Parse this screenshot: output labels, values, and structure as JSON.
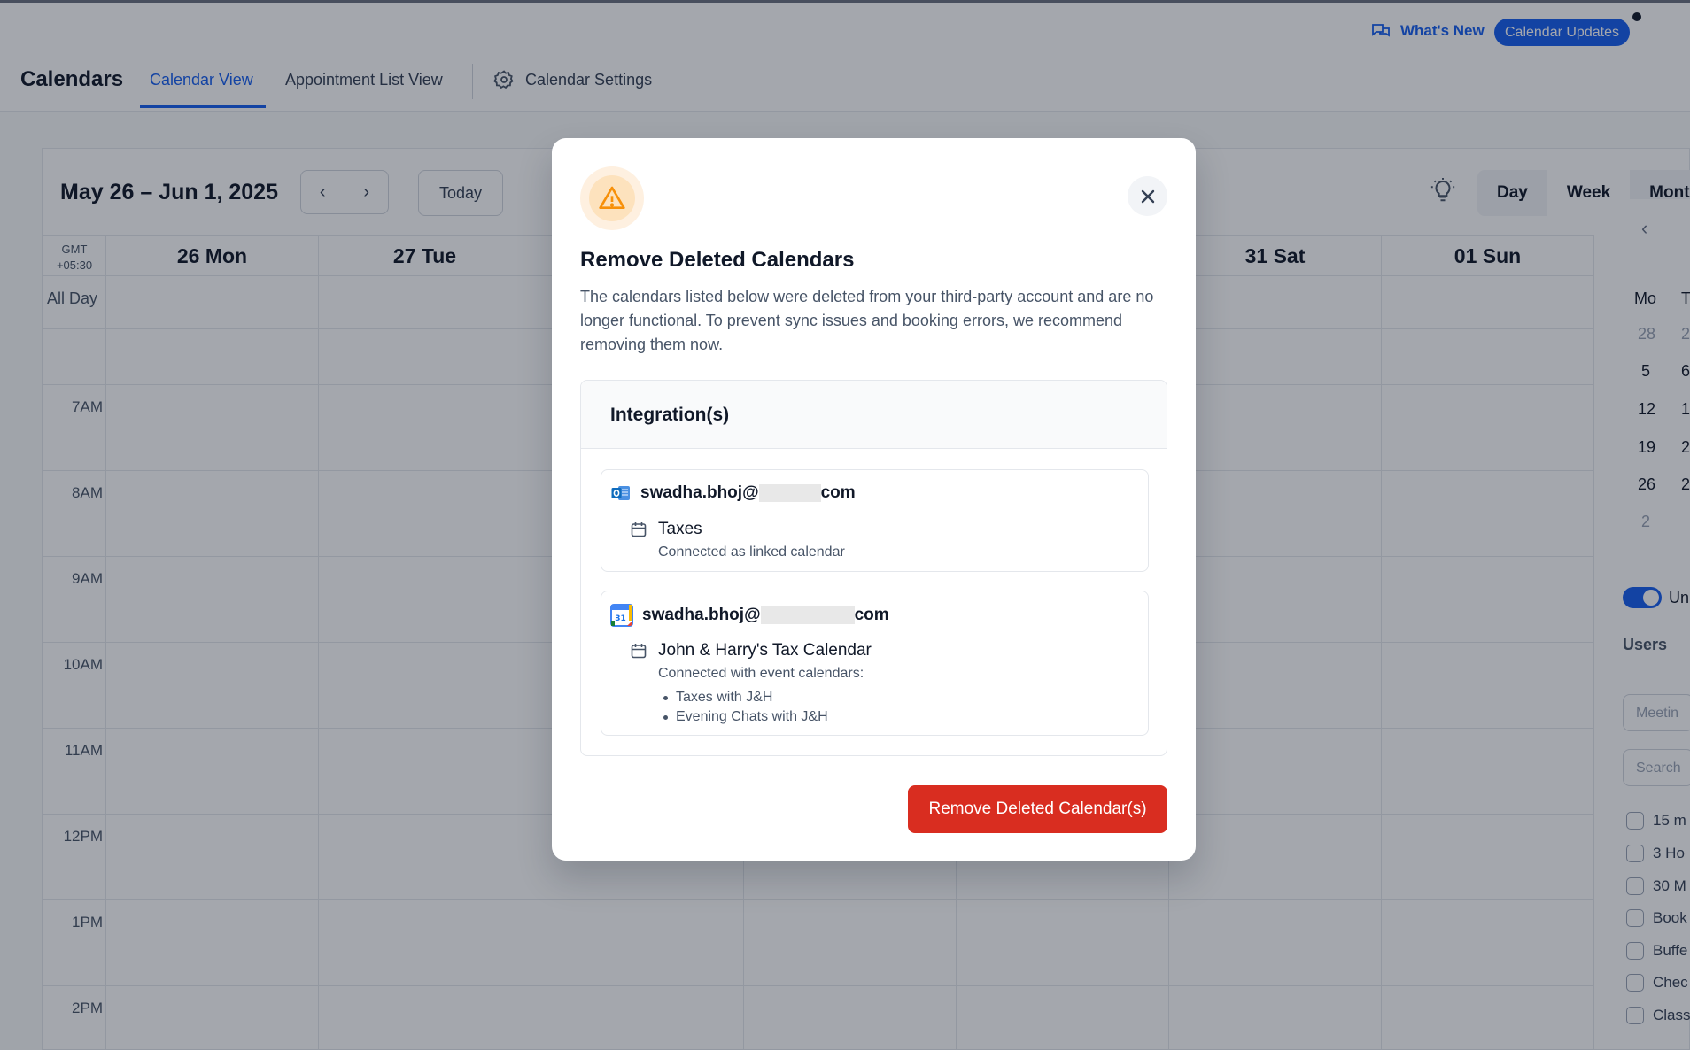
{
  "header": {
    "whats_new": "What's New",
    "updates_badge": "Calendar Updates"
  },
  "nav": {
    "title": "Calendars",
    "tabs": [
      "Calendar View",
      "Appointment List View"
    ],
    "settings": "Calendar Settings"
  },
  "calendar": {
    "range": "May 26 – Jun 1, 2025",
    "prev": "‹",
    "next": "›",
    "today": "Today",
    "views": [
      "Day",
      "Week",
      "Mont"
    ],
    "tz_line1": "GMT",
    "tz_line2": "+05:30",
    "all_day": "All Day",
    "days": [
      "26 Mon",
      "27 Tue",
      "",
      "",
      "",
      "31 Sat",
      "01 Sun"
    ],
    "hours": [
      "7AM",
      "8AM",
      "9AM",
      "10AM",
      "11AM",
      "12PM",
      "1PM",
      "2PM"
    ]
  },
  "sidebar": {
    "prev": "‹",
    "weekday_mo": "Mo",
    "weekday_tu": "T",
    "dates": [
      "28",
      "5",
      "12",
      "19",
      "26",
      "2"
    ],
    "dates_col2": [
      "2",
      "6",
      "1",
      "2",
      "2"
    ],
    "toggle_label": "Un",
    "users_label": "Users",
    "meeting_placeholder": "Meetin",
    "search_placeholder": "Search",
    "items": [
      "15 m",
      "3 Ho",
      "30 M",
      "Book",
      "Buffe",
      "Chec",
      "Class"
    ]
  },
  "modal": {
    "title": "Remove Deleted Calendars",
    "description": "The calendars listed below were deleted from your third-party account and are no longer functional. To prevent sync issues and booking errors, we recommend removing them now.",
    "section_header": "Integration(s)",
    "accounts": [
      {
        "email_prefix": "swadha.bhoj@",
        "email_suffix": "com",
        "provider_icon": "outlook-icon",
        "calendar_name": "Taxes",
        "status": "Connected as linked calendar",
        "event_calendars": []
      },
      {
        "email_prefix": "swadha.bhoj@",
        "email_suffix": "com",
        "provider_icon": "google-calendar-icon",
        "calendar_name": "John & Harry's Tax Calendar",
        "status": "Connected with event calendars:",
        "event_calendars": [
          "Taxes with J&H",
          "Evening Chats with J&H"
        ]
      }
    ],
    "remove_button": "Remove Deleted Calendar(s)"
  },
  "colors": {
    "accent": "#155eef",
    "danger": "#d92d20",
    "warning": "#f79009"
  }
}
